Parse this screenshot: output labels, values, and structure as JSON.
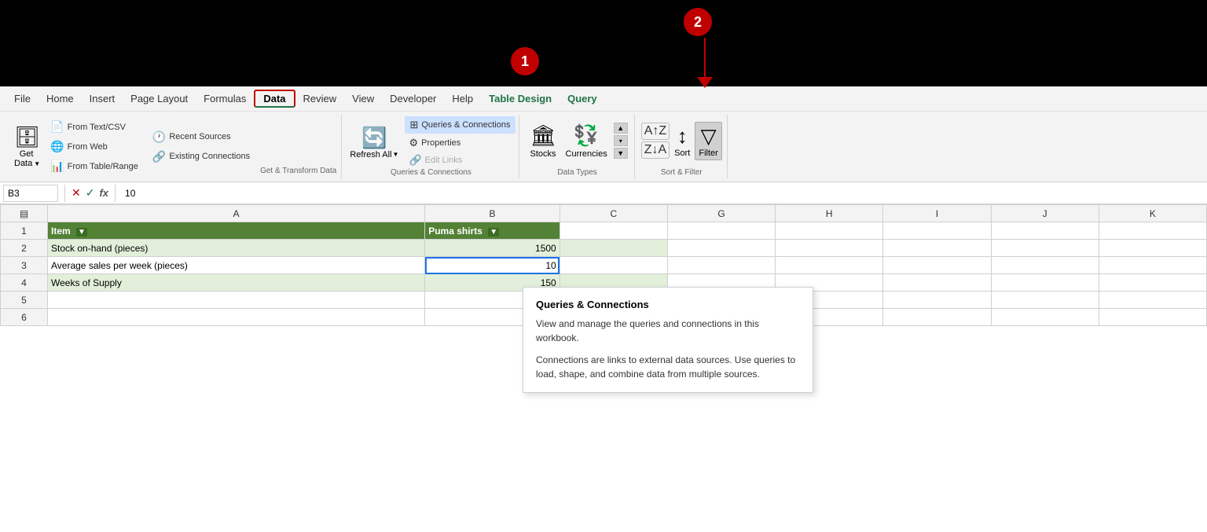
{
  "topBar": {
    "badge1": "1",
    "badge2": "2"
  },
  "menu": {
    "items": [
      {
        "label": "File",
        "active": false
      },
      {
        "label": "Home",
        "active": false
      },
      {
        "label": "Insert",
        "active": false
      },
      {
        "label": "Page Layout",
        "active": false
      },
      {
        "label": "Formulas",
        "active": false
      },
      {
        "label": "Data",
        "active": true
      },
      {
        "label": "Review",
        "active": false
      },
      {
        "label": "View",
        "active": false
      },
      {
        "label": "Developer",
        "active": false
      },
      {
        "label": "Help",
        "active": false
      },
      {
        "label": "Table Design",
        "active": false,
        "green": true
      },
      {
        "label": "Query",
        "active": false,
        "green": true
      }
    ]
  },
  "ribbon": {
    "groups": {
      "getData": {
        "label": "Get & Transform Data",
        "bigBtn": "Get\nData",
        "buttons": [
          {
            "icon": "📄",
            "label": "From Text/CSV"
          },
          {
            "icon": "🌐",
            "label": "From Web"
          },
          {
            "icon": "📊",
            "label": "From Table/Range"
          },
          {
            "icon": "🕐",
            "label": "Recent Sources"
          },
          {
            "icon": "🔗",
            "label": "Existing Connections"
          }
        ]
      },
      "queriesConnections": {
        "label": "Queries & Connections",
        "refreshAll": "Refresh\nAll",
        "dropdownItems": [
          {
            "label": "Queries & Connections",
            "active": true
          },
          {
            "label": "Properties"
          },
          {
            "label": "Edit Links",
            "disabled": true
          }
        ]
      },
      "dataTypes": {
        "label": "Data Types",
        "buttons": [
          {
            "icon": "🏛",
            "label": "Stocks"
          },
          {
            "icon": "💱",
            "label": "Currencies"
          }
        ]
      },
      "sortFilter": {
        "label": "Sort & Filter",
        "buttons": [
          {
            "label": "A→Z"
          },
          {
            "label": "Z→A"
          },
          {
            "label": "Sort"
          },
          {
            "label": "Filter"
          }
        ]
      }
    }
  },
  "formulaBar": {
    "cellRef": "B3",
    "value": "10"
  },
  "columnHeaders": [
    "",
    "A",
    "B",
    "C",
    "G",
    "H",
    "I",
    "J",
    "K"
  ],
  "rows": [
    {
      "rowNum": "1",
      "cells": [
        {
          "value": "Item",
          "style": "header-green"
        },
        {
          "value": "Puma shirts",
          "style": "header-green"
        },
        {
          "value": ""
        }
      ]
    },
    {
      "rowNum": "2",
      "cells": [
        {
          "value": "Stock on-hand (pieces)",
          "style": "row-alt-a"
        },
        {
          "value": "1500",
          "style": "row-alt-a cell-number"
        },
        {
          "value": ""
        }
      ]
    },
    {
      "rowNum": "3",
      "cells": [
        {
          "value": "Average sales per week (pieces)"
        },
        {
          "value": "10",
          "style": "cell-number cell-selected"
        },
        {
          "value": ""
        }
      ]
    },
    {
      "rowNum": "4",
      "cells": [
        {
          "value": "Weeks of Supply",
          "style": "row-alt-a"
        },
        {
          "value": "150",
          "style": "row-alt-a cell-number"
        },
        {
          "value": ""
        }
      ]
    },
    {
      "rowNum": "5",
      "cells": [
        {
          "value": ""
        },
        {
          "value": ""
        },
        {
          "value": ""
        }
      ]
    },
    {
      "rowNum": "6",
      "cells": [
        {
          "value": ""
        },
        {
          "value": ""
        },
        {
          "value": ""
        }
      ]
    }
  ],
  "tooltip": {
    "title": "Queries & Connections",
    "line1": "View and manage the queries and connections in this workbook.",
    "line2": "Connections are links to external data sources. Use queries to load, shape, and combine data from multiple sources."
  }
}
